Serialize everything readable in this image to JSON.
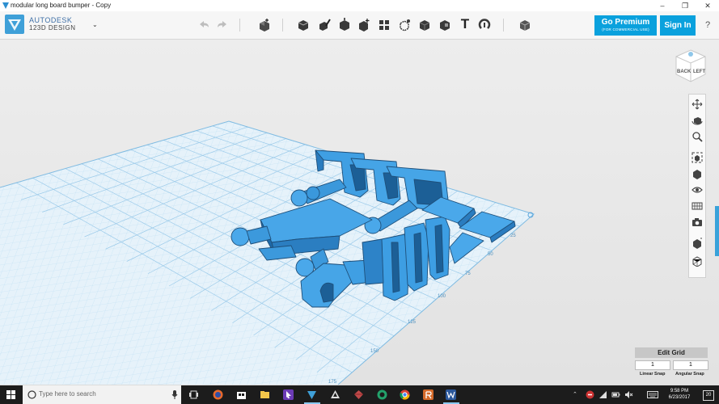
{
  "window": {
    "title": "modular long board bumper - Copy",
    "minimize": "–",
    "maximize": "❐",
    "close": "✕"
  },
  "brand": {
    "line1": "AUTODESK",
    "line2": "123D DESIGN",
    "menu_caret": "⌄"
  },
  "toolbar": {
    "undo_icon": "undo-icon",
    "redo_icon": "redo-icon",
    "tools": [
      "transform",
      "primitives",
      "sketch",
      "construct",
      "modify",
      "pattern",
      "grouping",
      "combine",
      "measure",
      "text",
      "snap",
      "material"
    ],
    "text_tool_glyph": "T"
  },
  "premium": {
    "label": "Go Premium",
    "sub": "(FOR COMMERCIAL USE)"
  },
  "signin": {
    "label": "Sign In"
  },
  "help": {
    "label": "?"
  },
  "viewcube": {
    "face_back": "BACK",
    "face_left": "LEFT"
  },
  "grid_ticks": [
    "25",
    "50",
    "75",
    "100",
    "125",
    "150",
    "175"
  ],
  "grid_panel": {
    "title": "Edit Grid",
    "linear_value": "1",
    "angular_value": "1",
    "linear_label": "Linear Snap",
    "angular_label": "Angular Snap"
  },
  "taskbar": {
    "search_placeholder": "Type here to search",
    "time": "9:58 PM",
    "date": "6/23/2017",
    "notifications": "20"
  },
  "colors": {
    "accent": "#0aa1dd",
    "model": "#3d9ee3",
    "grid": "#a7d2ee"
  }
}
